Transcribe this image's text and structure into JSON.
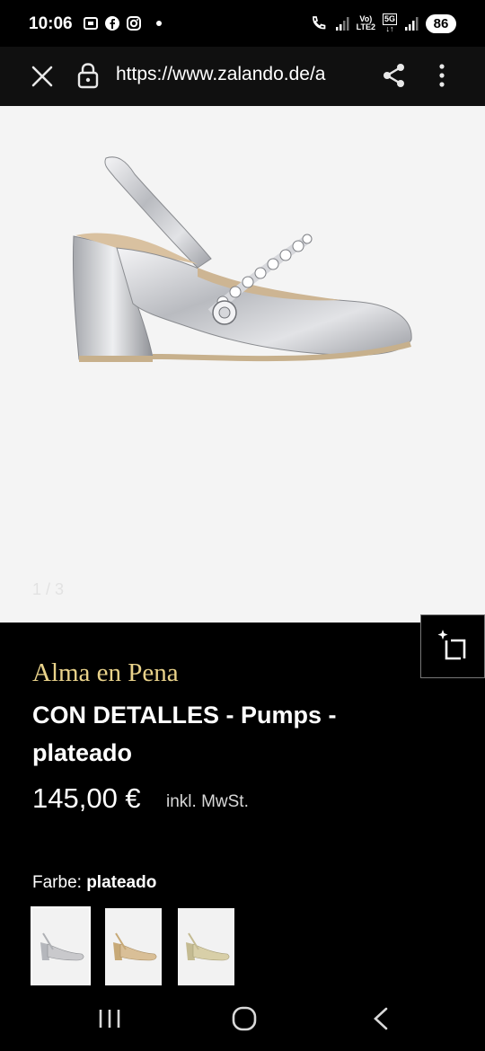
{
  "status_bar": {
    "time": "10:06",
    "net_label_top": "Vo)",
    "net_label_bottom": "LTE2",
    "net_5g": "5G",
    "battery": "86"
  },
  "browser": {
    "url": "https://www.zalando.de/a"
  },
  "gallery": {
    "counter": "1 / 3"
  },
  "product": {
    "brand": "Alma en Pena",
    "title": "CON DETALLES - Pumps - plateado",
    "price": "145,00 €",
    "tax_note": "inkl. MwSt.",
    "color_label": "Farbe:",
    "color_value": "plateado",
    "swatches": [
      {
        "color": "silver",
        "fill": "#c9c9cc"
      },
      {
        "color": "beige",
        "fill": "#d9bf97"
      },
      {
        "color": "gold",
        "fill": "#d8cfa8"
      }
    ]
  },
  "colors": {
    "brand_gold": "#e9d28a",
    "background": "#000000",
    "image_bg": "#f4f4f4"
  }
}
